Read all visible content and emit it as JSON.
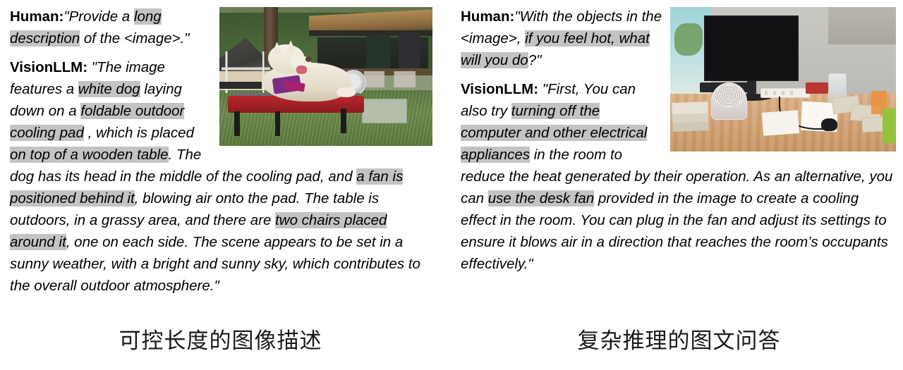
{
  "panels": [
    {
      "id": "controllable-caption",
      "caption": "可控长度的图像描述",
      "photo_alt": "white-dog-on-cooling-pad",
      "turns": [
        {
          "speaker": "Human:",
          "segments": [
            {
              "text": "\"Provide a ",
              "highlight": false
            },
            {
              "text": "long description",
              "highlight": true
            },
            {
              "text": " of the <image>.\"",
              "highlight": false
            }
          ]
        },
        {
          "speaker": "VisionLLM:",
          "segments": [
            {
              "text": " \"The image features a ",
              "highlight": false
            },
            {
              "text": "white dog",
              "highlight": true
            },
            {
              "text": " laying down on a ",
              "highlight": false
            },
            {
              "text": "foldable outdoor cooling pad",
              "highlight": true
            },
            {
              "text": " , which is placed ",
              "highlight": false
            },
            {
              "text": "on top of a wooden table",
              "highlight": true
            },
            {
              "text": ". The dog has its head in the middle of the cooling pad, and ",
              "highlight": false
            },
            {
              "text": "a fan is positioned behind it",
              "highlight": true
            },
            {
              "text": ", blowing air onto the pad. The table is outdoors, in a grassy area, and there are ",
              "highlight": false
            },
            {
              "text": "two chairs placed around it",
              "highlight": true
            },
            {
              "text": ", one on each side. The scene appears to be set in a sunny weather, with a bright and sunny sky, which contributes to the overall outdoor atmosphere.\"",
              "highlight": false
            }
          ]
        }
      ]
    },
    {
      "id": "complex-reasoning-vqa",
      "caption": "复杂推理的图文问答",
      "photo_alt": "office-desk-with-monitor-and-fan",
      "turns": [
        {
          "speaker": "Human:",
          "segments": [
            {
              "text": "\"With the objects in the <image>, ",
              "highlight": false
            },
            {
              "text": "if you feel hot, what will you do",
              "highlight": true
            },
            {
              "text": "?\"",
              "highlight": false
            }
          ]
        },
        {
          "speaker": "VisionLLM:",
          "segments": [
            {
              "text": " \"First, You can also try ",
              "highlight": false
            },
            {
              "text": "turning off the computer and other electrical appliances",
              "highlight": true
            },
            {
              "text": " in the room to reduce the heat generated by their operation. As an alternative, you can ",
              "highlight": false
            },
            {
              "text": "use the desk fan",
              "highlight": true
            },
            {
              "text": " provided in the image to create a cooling effect in the room. You can plug in the fan and adjust its settings to ensure it blows air in a direction that reaches the room’s occupants effectively.\"",
              "highlight": false
            }
          ]
        }
      ]
    }
  ],
  "colors": {
    "highlight": "#c3c3c3",
    "text": "#000000",
    "background": "#ffffff"
  }
}
